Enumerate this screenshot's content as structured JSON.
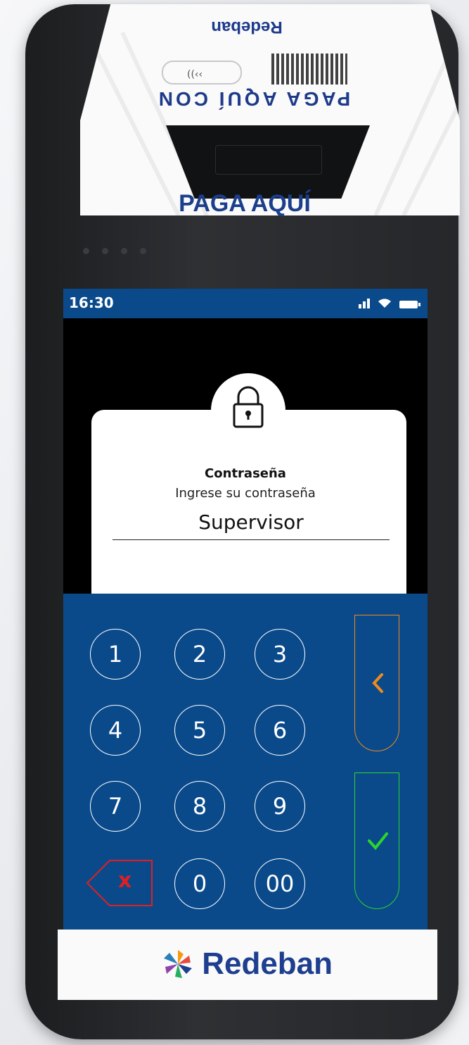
{
  "device": {
    "cap_brand_mirrored": "Redeban",
    "cap_text_mirrored": "PAGA AQUÍ CON",
    "cap_title": "PAGA AQUÍ",
    "brand": "Redeban"
  },
  "status_bar": {
    "time": "16:30",
    "icons": [
      "signal-icon",
      "wifi-icon",
      "battery-icon"
    ]
  },
  "dialog": {
    "title": "Contraseña",
    "subtitle": "Ingrese su contraseña",
    "input_value": "Supervisor",
    "icon": "lock-icon"
  },
  "keypad": {
    "keys": [
      "1",
      "2",
      "3",
      "4",
      "5",
      "6",
      "7",
      "8",
      "9",
      "0",
      "00"
    ],
    "delete_label": "x",
    "back_icon": "chevron-left-icon",
    "confirm_icon": "check-icon"
  },
  "colors": {
    "brand_blue": "#0a4a8b",
    "back_accent": "#f08a1c",
    "confirm_accent": "#2bd62b",
    "delete_accent": "#e02020"
  }
}
